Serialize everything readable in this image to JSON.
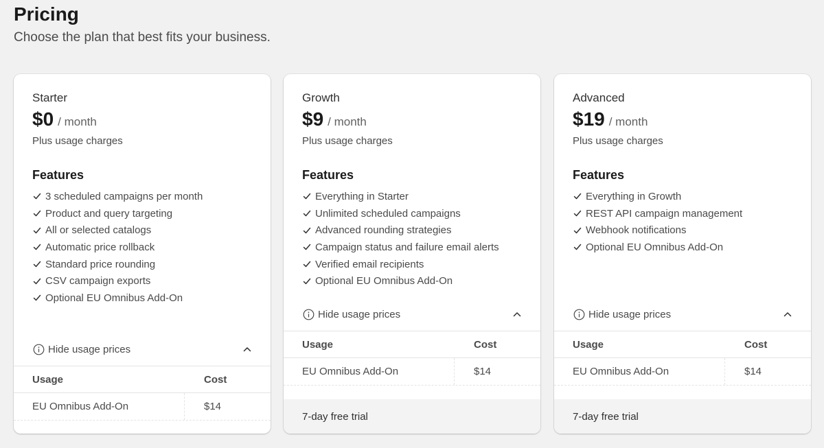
{
  "header": {
    "title": "Pricing",
    "subtitle": "Choose the plan that best fits your business."
  },
  "plans": [
    {
      "name": "Starter",
      "price": "$0",
      "period": "/ month",
      "usage_note": "Plus usage charges",
      "features_title": "Features",
      "features": [
        "3 scheduled campaigns per month",
        "Product and query targeting",
        "All or selected catalogs",
        "Automatic price rollback",
        "Standard price rounding",
        "CSV campaign exports",
        "Optional EU Omnibus Add-On"
      ],
      "toggle_label": "Hide usage prices",
      "table": {
        "headers": [
          "Usage",
          "Cost"
        ],
        "rows": [
          [
            "EU Omnibus Add-On",
            "$14"
          ]
        ]
      },
      "trial": ""
    },
    {
      "name": "Growth",
      "price": "$9",
      "period": "/ month",
      "usage_note": "Plus usage charges",
      "features_title": "Features",
      "features": [
        "Everything in Starter",
        "Unlimited scheduled campaigns",
        "Advanced rounding strategies",
        "Campaign status and failure email alerts",
        "Verified email recipients",
        "Optional EU Omnibus Add-On"
      ],
      "toggle_label": "Hide usage prices",
      "table": {
        "headers": [
          "Usage",
          "Cost"
        ],
        "rows": [
          [
            "EU Omnibus Add-On",
            "$14"
          ]
        ]
      },
      "trial": "7-day free trial"
    },
    {
      "name": "Advanced",
      "price": "$19",
      "period": "/ month",
      "usage_note": "Plus usage charges",
      "features_title": "Features",
      "features": [
        "Everything in Growth",
        "REST API campaign management",
        "Webhook notifications",
        "Optional EU Omnibus Add-On"
      ],
      "toggle_label": "Hide usage prices",
      "table": {
        "headers": [
          "Usage",
          "Cost"
        ],
        "rows": [
          [
            "EU Omnibus Add-On",
            "$14"
          ]
        ]
      },
      "trial": "7-day free trial"
    }
  ],
  "icons": {
    "check": "check-icon",
    "info": "info-icon",
    "chevron": "chevron-up-icon"
  },
  "colors": {
    "background": "#f1f1f1",
    "card": "#ffffff",
    "text": "#303030",
    "muted": "#616161",
    "footer": "#f3f3f3"
  }
}
